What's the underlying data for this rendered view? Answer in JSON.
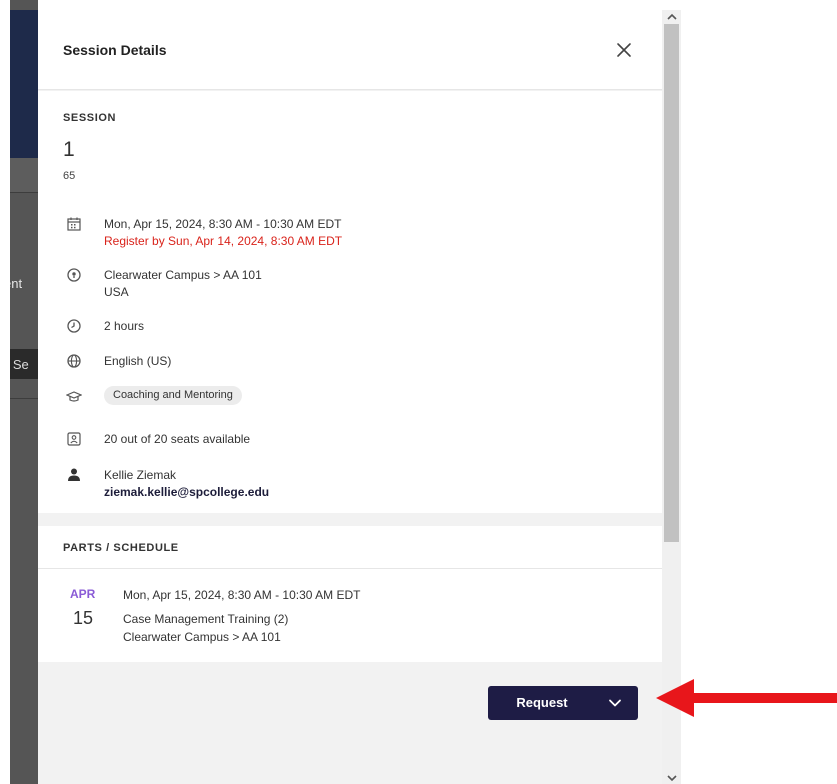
{
  "background_page": {
    "partial_text_1": "ent",
    "partial_button_text": "a Se"
  },
  "panel": {
    "title": "Session Details",
    "close_icon": "close-icon"
  },
  "session": {
    "section_label": "SESSION",
    "number": "1",
    "subtitle": "65",
    "date_time": "Mon, Apr 15, 2024, 8:30 AM - 10:30 AM EDT",
    "register_by": "Register by Sun, Apr 14, 2024, 8:30 AM EDT",
    "location_line1": "Clearwater Campus > AA 101",
    "location_line2": "USA",
    "duration": "2 hours",
    "language": "English (US)",
    "topic_chip": "Coaching and Mentoring",
    "seats": "20 out of 20 seats available",
    "instructor_name": "Kellie Ziemak",
    "instructor_email": "ziemak.kellie@spcollege.edu",
    "icons": [
      "calendar-icon",
      "location-pin-icon",
      "clock-icon",
      "globe-icon",
      "graduation-cap-icon",
      "seat-badge-icon",
      "person-icon"
    ]
  },
  "parts": {
    "section_label": "PARTS / SCHEDULE",
    "items": [
      {
        "month": "APR",
        "day": "15",
        "when": "Mon, Apr 15, 2024, 8:30 AM - 10:30 AM EDT",
        "name": "Case Management Training (2)",
        "location": "Clearwater Campus > AA 101"
      }
    ]
  },
  "footer": {
    "request_label": "Request"
  },
  "colors": {
    "accent_dark": "#1e1c45",
    "register_red": "#d9231b",
    "month_purple": "#8a5bd6",
    "annotation_arrow": "#e8161b"
  }
}
